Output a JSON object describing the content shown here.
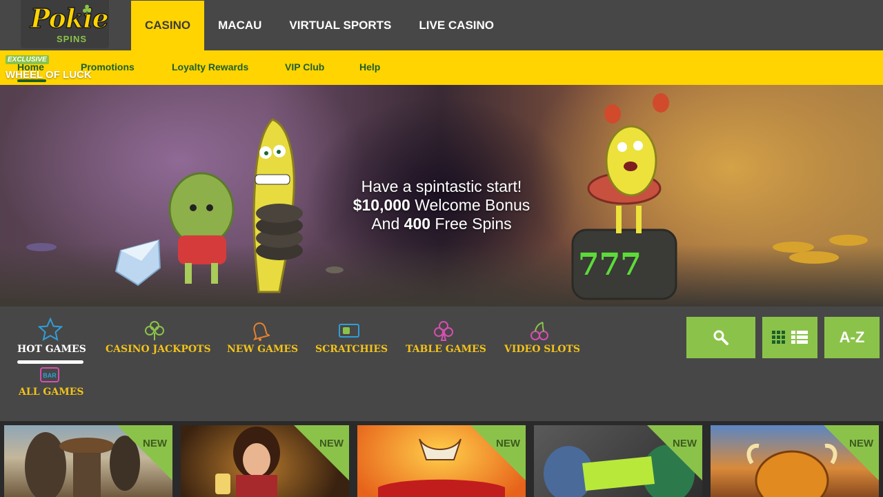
{
  "brand": {
    "logo_text": "Pokie",
    "logo_sub": "SPINS"
  },
  "top_tabs": [
    {
      "label": "CASINO",
      "active": true
    },
    {
      "label": "MACAU",
      "active": false
    },
    {
      "label": "VIRTUAL SPORTS",
      "active": false
    },
    {
      "label": "LIVE CASINO",
      "active": false
    }
  ],
  "sub_nav": {
    "items": [
      "Home",
      "Promotions",
      "Loyalty Rewards",
      "VIP Club",
      "Help"
    ],
    "active": "Home",
    "badge": "EXCLUSIVE",
    "feature_label": "WHEEL OF LUCK"
  },
  "hero": {
    "line1": "Have a spintastic start!",
    "line2_bold": "$10,000",
    "line2_rest": " Welcome Bonus",
    "line3_pre": "And ",
    "line3_bold": "400",
    "line3_rest": " Free Spins"
  },
  "categories": [
    {
      "label": "HOT GAMES",
      "icon": "star-icon",
      "active": true
    },
    {
      "label": "CASINO JACKPOTS",
      "icon": "clover-icon",
      "active": false
    },
    {
      "label": "NEW GAMES",
      "icon": "bell-icon",
      "active": false
    },
    {
      "label": "SCRATCHIES",
      "icon": "ticket-icon",
      "active": false
    },
    {
      "label": "TABLE GAMES",
      "icon": "club-icon",
      "active": false
    },
    {
      "label": "VIDEO SLOTS",
      "icon": "cherries-icon",
      "active": false
    },
    {
      "label": "ALL GAMES",
      "icon": "bar-icon",
      "active": false
    }
  ],
  "tools": {
    "search": "search-icon",
    "view_toggle": "grid-list-icon",
    "sort": "A-Z"
  },
  "games": [
    {
      "badge": "NEW"
    },
    {
      "badge": "NEW"
    },
    {
      "badge": "NEW"
    },
    {
      "badge": "NEW"
    },
    {
      "badge": "NEW"
    }
  ],
  "colors": {
    "accent_yellow": "#ffd400",
    "accent_green": "#8bc34a",
    "bar_gray": "#474747",
    "nav_text_green": "#1d5e2a"
  }
}
